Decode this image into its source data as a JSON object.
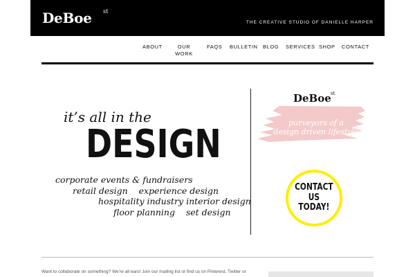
{
  "header": {
    "logo": "DeBoe",
    "logo_mark": "st",
    "tagline": "THE CREATIVE STUDIO OF DANIELLE HARPER"
  },
  "nav": {
    "about": "ABOUT",
    "our_work_line1": "OUR",
    "our_work_line2": "WORK",
    "faqs": "FAQS",
    "bulletin": "BULLETIN",
    "blog": "BLOG",
    "services": "SERVICES",
    "shop": "SHOP",
    "contact": "CONTACT"
  },
  "hero": {
    "script": "it’s all in the",
    "big": "DESIGN",
    "services": [
      "corporate events & fundraisers",
      "retail design    experience design",
      "hospitality industry interior design",
      "floor planning    set design"
    ]
  },
  "sidebar": {
    "logo": "DeBoe",
    "logo_mark": "st",
    "tagline_line1": "purveyors of a",
    "tagline_line2": "design driven lifestyle",
    "contact_line1": "CONTACT",
    "contact_line2": "US",
    "contact_line3": "TODAY!"
  },
  "footer": {
    "text": "Want to collaborate on something?  We’re all ears!  Join our mailing list or find us on Pinterest, Twitter or"
  },
  "colors": {
    "topbar": "#000000",
    "brush": "#f4c9c9",
    "contact_ring": "#ffee00"
  }
}
